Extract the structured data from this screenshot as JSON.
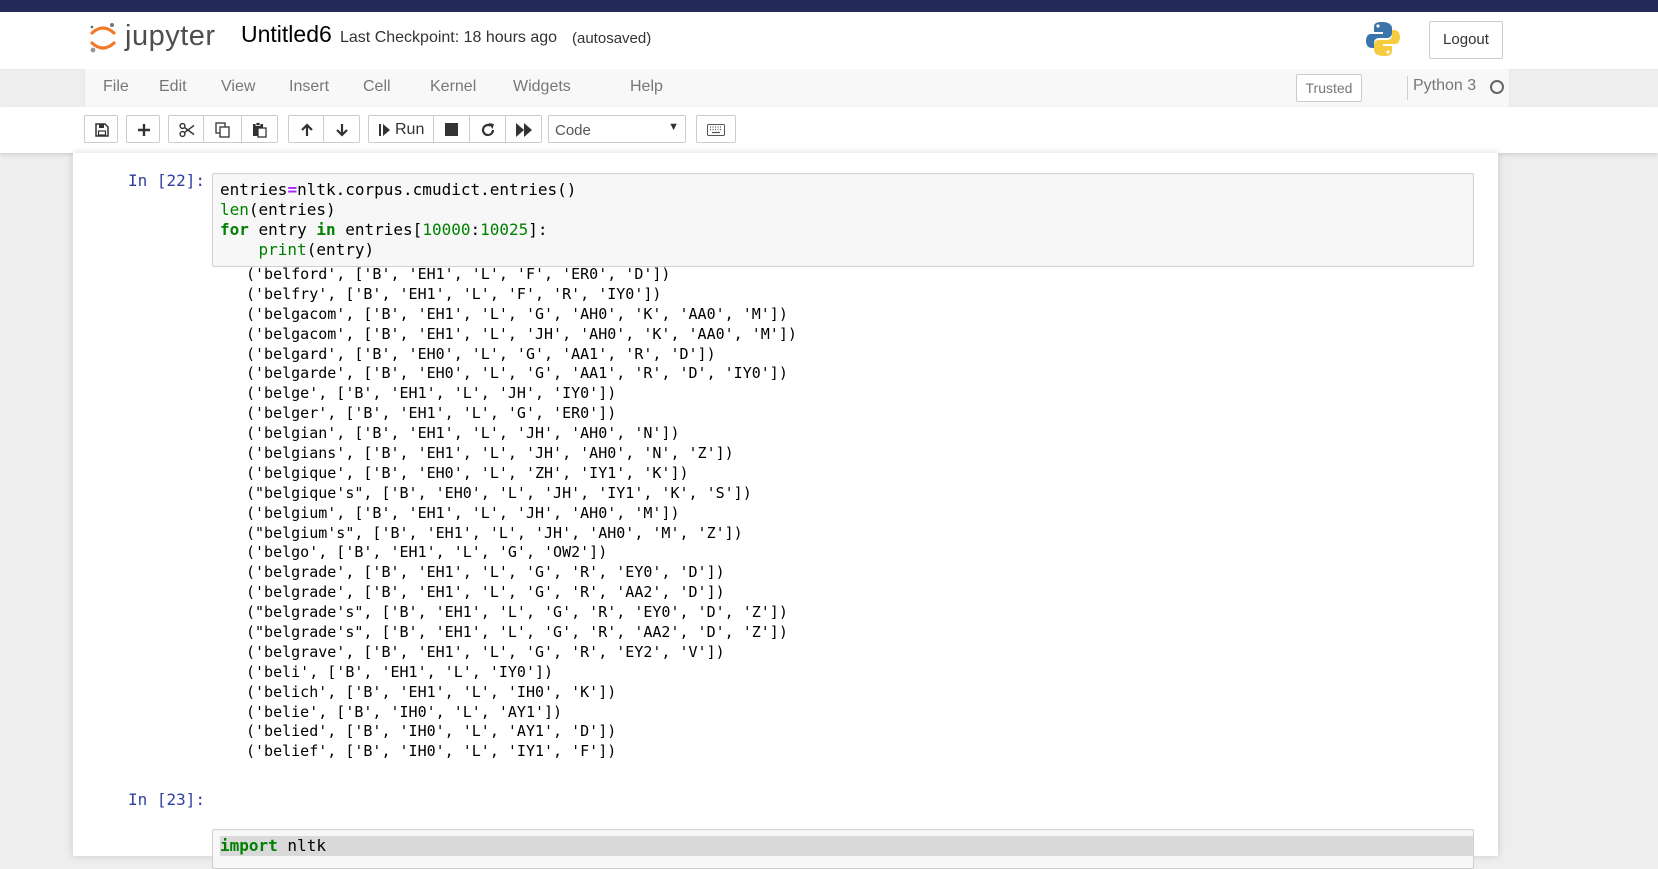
{
  "header": {
    "logo_text": "jupyter",
    "notebook_name": "Untitled6",
    "checkpoint": "Last Checkpoint: 18 hours ago",
    "autosave": "(autosaved)",
    "logout_label": "Logout"
  },
  "menubar": {
    "items": [
      "File",
      "Edit",
      "View",
      "Insert",
      "Cell",
      "Kernel",
      "Widgets",
      "Help"
    ],
    "trusted_label": "Trusted",
    "kernel_name": "Python 3"
  },
  "toolbar": {
    "run_label": "Run",
    "cell_type": "Code",
    "icons": [
      "save-icon",
      "plus-icon",
      "scissors-icon",
      "copy-icon",
      "paste-icon",
      "arrow-up-icon",
      "arrow-down-icon",
      "run-icon",
      "stop-icon",
      "restart-icon",
      "fast-forward-icon",
      "keyboard-icon"
    ]
  },
  "cells": [
    {
      "prompt": "In [22]:",
      "code": [
        "entries=nltk.corpus.cmudict.entries()",
        "len(entries)",
        "for entry in entries[10000:10025]:",
        "    print(entry)"
      ],
      "output": [
        "('belford', ['B', 'EH1', 'L', 'F', 'ER0', 'D'])",
        "('belfry', ['B', 'EH1', 'L', 'F', 'R', 'IY0'])",
        "('belgacom', ['B', 'EH1', 'L', 'G', 'AH0', 'K', 'AA0', 'M'])",
        "('belgacom', ['B', 'EH1', 'L', 'JH', 'AH0', 'K', 'AA0', 'M'])",
        "('belgard', ['B', 'EH0', 'L', 'G', 'AA1', 'R', 'D'])",
        "('belgarde', ['B', 'EH0', 'L', 'G', 'AA1', 'R', 'D', 'IY0'])",
        "('belge', ['B', 'EH1', 'L', 'JH', 'IY0'])",
        "('belger', ['B', 'EH1', 'L', 'G', 'ER0'])",
        "('belgian', ['B', 'EH1', 'L', 'JH', 'AH0', 'N'])",
        "('belgians', ['B', 'EH1', 'L', 'JH', 'AH0', 'N', 'Z'])",
        "('belgique', ['B', 'EH0', 'L', 'ZH', 'IY1', 'K'])",
        "(\"belgique's\", ['B', 'EH0', 'L', 'JH', 'IY1', 'K', 'S'])",
        "('belgium', ['B', 'EH1', 'L', 'JH', 'AH0', 'M'])",
        "(\"belgium's\", ['B', 'EH1', 'L', 'JH', 'AH0', 'M', 'Z'])",
        "('belgo', ['B', 'EH1', 'L', 'G', 'OW2'])",
        "('belgrade', ['B', 'EH1', 'L', 'G', 'R', 'EY0', 'D'])",
        "('belgrade', ['B', 'EH1', 'L', 'G', 'R', 'AA2', 'D'])",
        "(\"belgrade's\", ['B', 'EH1', 'L', 'G', 'R', 'EY0', 'D', 'Z'])",
        "(\"belgrade's\", ['B', 'EH1', 'L', 'G', 'R', 'AA2', 'D', 'Z'])",
        "('belgrave', ['B', 'EH1', 'L', 'G', 'R', 'EY2', 'V'])",
        "('beli', ['B', 'EH1', 'L', 'IY0'])",
        "('belich', ['B', 'EH1', 'L', 'IH0', 'K'])",
        "('belie', ['B', 'IH0', 'L', 'AY1'])",
        "('belied', ['B', 'IH0', 'L', 'AY1', 'D'])",
        "('belief', ['B', 'IH0', 'L', 'IY1', 'F'])"
      ]
    },
    {
      "prompt": "In [23]:",
      "code": [
        "import nltk"
      ]
    }
  ],
  "colors": {
    "prompt": "#303f9f",
    "keyword": "#008000",
    "operator": "#aa22ff",
    "topbar": "#232a59",
    "logo_orange": "#f37726"
  }
}
